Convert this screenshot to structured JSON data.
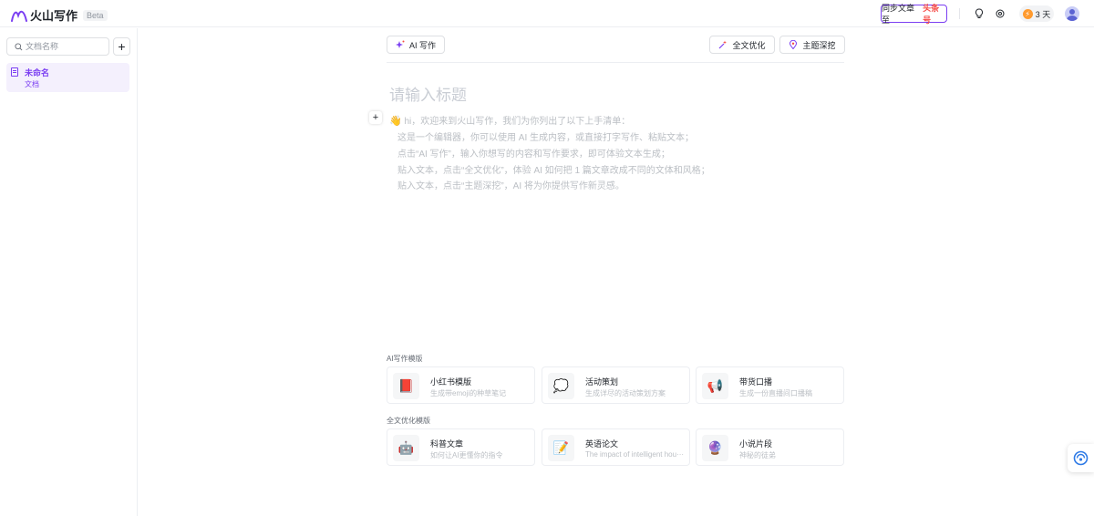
{
  "header": {
    "app_name": "火山写作",
    "beta_badge": "Beta",
    "sync_label": "同步文章至",
    "sync_target": "头条号",
    "streak_days": "3 天"
  },
  "sidebar": {
    "search_placeholder": "文档名称",
    "docs": [
      {
        "title": "未命名",
        "type": "文档"
      }
    ]
  },
  "toolbar": {
    "ai_write": "AI 写作",
    "optimize": "全文优化",
    "topic_dig": "主题深挖"
  },
  "editor": {
    "title_placeholder": "请输入标题",
    "intro_emoji": "👋",
    "intro": "hi，欢迎来到火山写作，我们为你列出了以下上手清单：",
    "lines": [
      "这是一个编辑器，你可以使用 AI 生成内容，或直接打字写作、粘贴文本；",
      "点击“AI 写作”，输入你想写的内容和写作要求，即可体验文本生成；",
      "贴入文本，点击“全文优化”，体验 AI 如何把 1 篇文章改成不同的文体和风格；",
      "贴入文本，点击“主题深挖”，AI 将为你提供写作新灵感。"
    ]
  },
  "templates": {
    "ai_section": "AI写作模版",
    "ai_items": [
      {
        "icon": "📕",
        "name": "小红书模版",
        "desc": "生成带emoji的种草笔记"
      },
      {
        "icon": "💭",
        "name": "活动策划",
        "desc": "生成详尽的活动策划方案"
      },
      {
        "icon": "📢",
        "name": "带货口播",
        "desc": "生成一份直播间口播稿"
      }
    ],
    "opt_section": "全文优化模版",
    "opt_items": [
      {
        "icon": "🤖",
        "name": "科普文章",
        "desc": "如何让AI更懂你的指令"
      },
      {
        "icon": "📝",
        "name": "英语论文",
        "desc": "The impact of intelligent hou···"
      },
      {
        "icon": "🔮",
        "name": "小说片段",
        "desc": "神秘的徒弟"
      }
    ]
  },
  "colors": {
    "brand": "#7b3ff2",
    "highlight": "#f54a45"
  }
}
